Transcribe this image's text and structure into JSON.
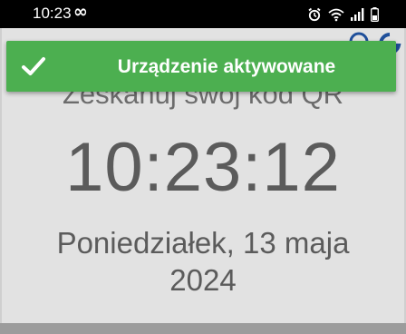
{
  "status_bar": {
    "time": "10:23",
    "icons": [
      "infinity-icon",
      "alarm-icon",
      "wifi-icon",
      "signal-icon",
      "battery-icon"
    ]
  },
  "app": {
    "scan_prompt": "Zeskanuj swój kod QR",
    "clock": "10:23:12",
    "date_line1": "Poniedziałek, 13 maja",
    "date_line2": "2024"
  },
  "toast": {
    "message": "Urządzenie aktywowane",
    "icon": "checkmark-icon",
    "color": "#4caf50"
  },
  "colors": {
    "background": "#e2e2e2",
    "text": "#5b5b5b",
    "status_bar": "#000000",
    "logo_blue": "#1f4f9a"
  }
}
